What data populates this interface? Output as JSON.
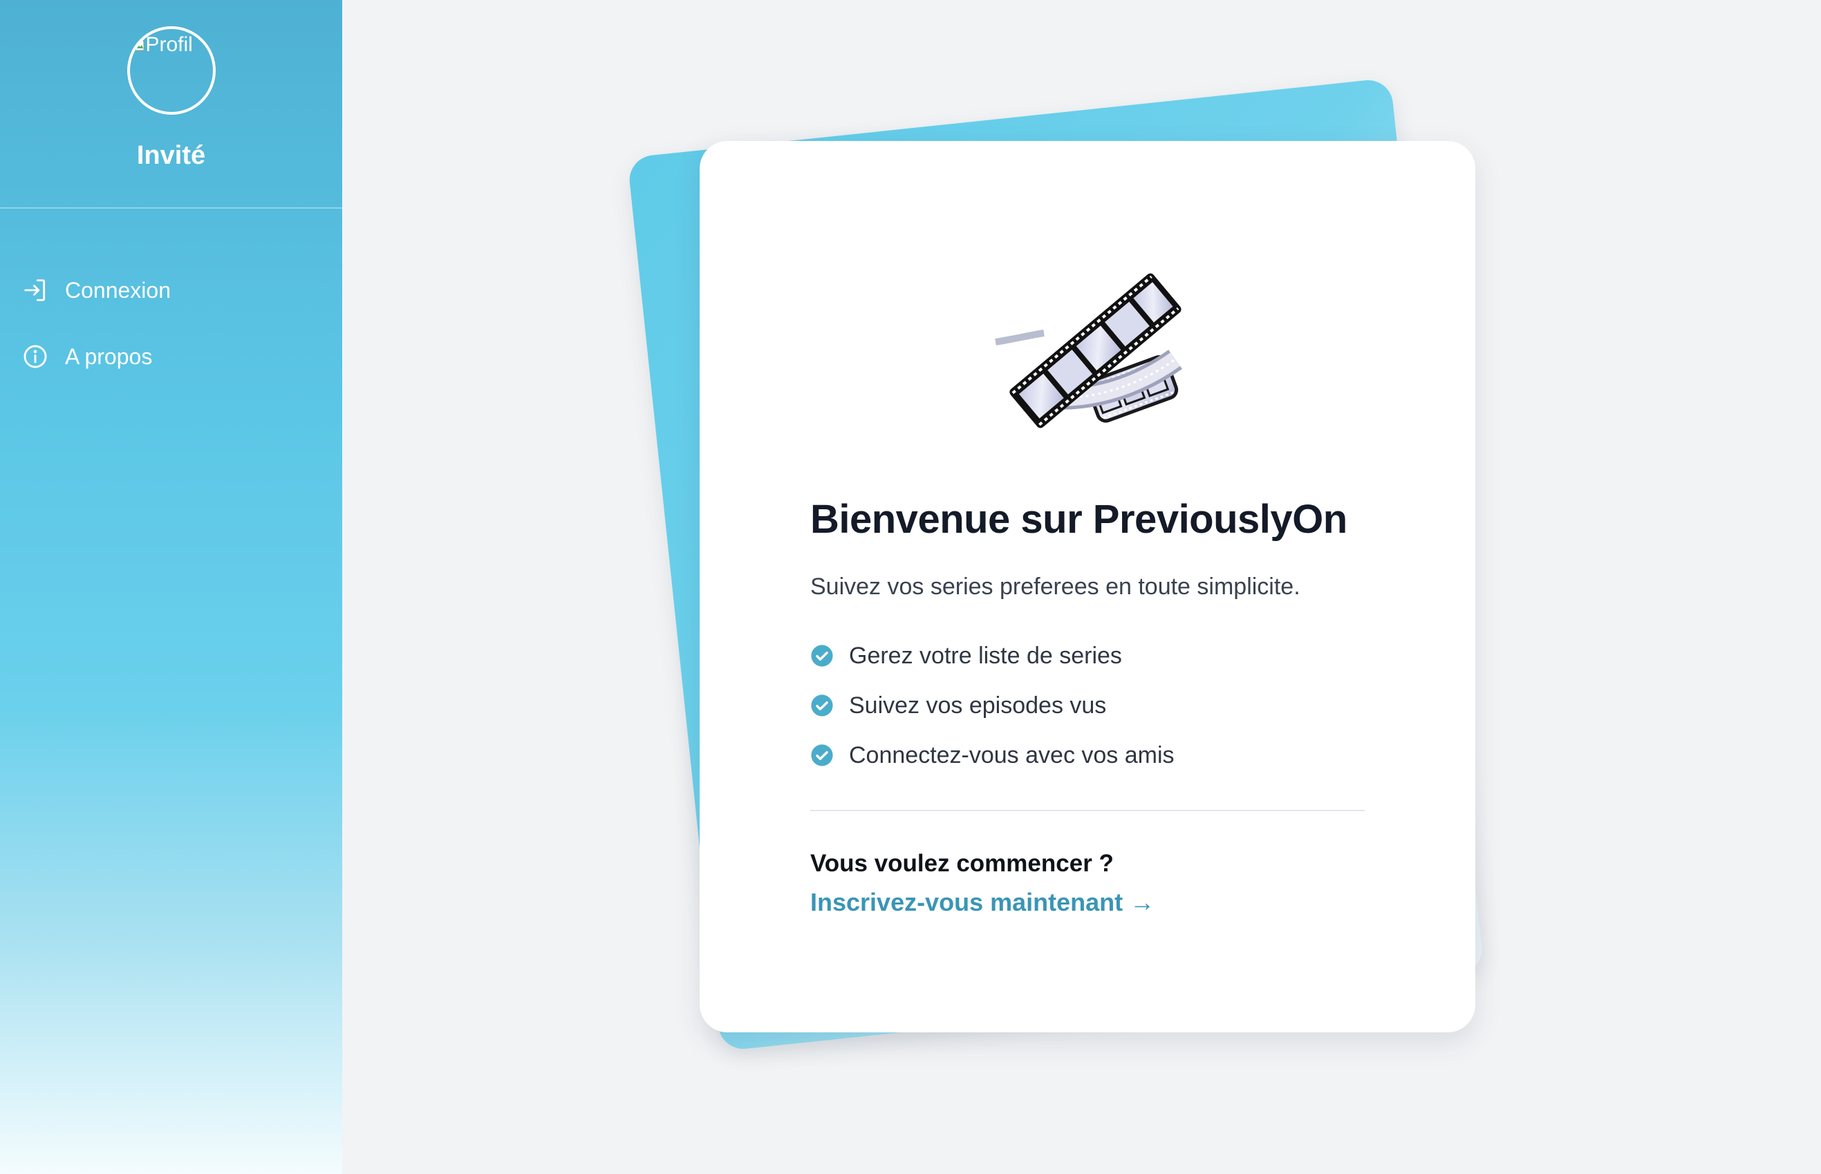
{
  "sidebar": {
    "avatar_alt": "Profil",
    "user_name": "Invité",
    "items": [
      {
        "label": "Connexion",
        "icon": "login-icon"
      },
      {
        "label": "A propos",
        "icon": "info-icon"
      }
    ]
  },
  "welcome": {
    "title": "Bienvenue sur PreviouslyOn",
    "subtitle": "Suivez vos series preferees en toute simplicite.",
    "features": [
      "Gerez votre liste de series",
      "Suivez vos episodes vus",
      "Connectez-vous avec vos amis"
    ],
    "cta_question": "Vous voulez commencer ?",
    "cta_link": "Inscrivez-vous maintenant →"
  },
  "colors": {
    "accent": "#4eb1d3",
    "link": "#3a95b5",
    "check": "#4aaccb"
  },
  "icons": {
    "hero": "film-reel-icon",
    "feature": "check-circle-icon"
  }
}
